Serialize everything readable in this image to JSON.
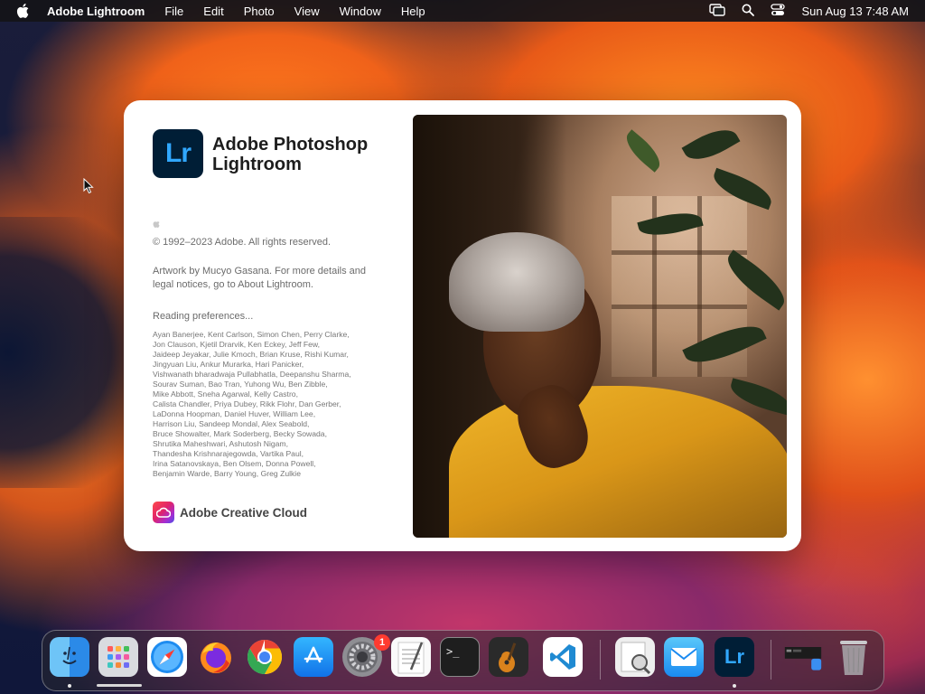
{
  "menubar": {
    "app_name": "Adobe Lightroom",
    "items": [
      "File",
      "Edit",
      "Photo",
      "View",
      "Window",
      "Help"
    ],
    "clock": "Sun Aug 13  7:48 AM"
  },
  "splash": {
    "logo_text": "Lr",
    "product_name": "Adobe Photoshop Lightroom",
    "copyright": "© 1992–2023 Adobe. All rights reserved.",
    "artwork_credit": "Artwork by Mucyo Gasana. For more details and legal notices, go to About Lightroom.",
    "status": "Reading preferences...",
    "credits": [
      "Ayan Banerjee, Kent Carlson, Simon Chen, Perry Clarke,",
      "Jon Clauson, Kjetil Drarvik, Ken Eckey, Jeff Few,",
      "Jaideep Jeyakar, Julie Kmoch, Brian Kruse, Rishi Kumar,",
      "Jingyuan Liu, Ankur Murarka, Hari Panicker,",
      "Vishwanath bharadwaja Pullabhatla, Deepanshu Sharma,",
      "Sourav Suman, Bao Tran, Yuhong Wu, Ben Zibble,",
      "Mike Abbott, Sneha Agarwal, Kelly Castro,",
      "Calista Chandler, Priya Dubey, Rikk Flohr, Dan Gerber,",
      "LaDonna Hoopman, Daniel Huver, William Lee,",
      "Harrison Liu, Sandeep Mondal, Alex Seabold,",
      "Bruce Showalter, Mark Soderberg, Becky Sowada,",
      "Shrutika Maheshwari, Ashutosh Nigam,",
      "Thandesha Krishnarajegowda, Vartika Paul,",
      "Irina Satanovskaya, Ben Olsem, Donna Powell,",
      "Benjamin Warde, Barry Young, Greg Zulkie"
    ],
    "creative_cloud_label": "Adobe Creative Cloud"
  },
  "dock": {
    "apps": [
      {
        "name": "Finder",
        "icon": "finder-icon",
        "running": true
      },
      {
        "name": "Launchpad",
        "icon": "launchpad-icon",
        "running": false
      },
      {
        "name": "Safari",
        "icon": "safari-icon",
        "running": false
      },
      {
        "name": "Firefox",
        "icon": "firefox-icon",
        "running": false
      },
      {
        "name": "Chrome",
        "icon": "chrome-icon",
        "running": false
      },
      {
        "name": "App Store",
        "icon": "app-store-icon",
        "running": false
      },
      {
        "name": "System Settings",
        "icon": "system-settings-icon",
        "running": false,
        "badge": "1"
      },
      {
        "name": "TextEdit",
        "icon": "textedit-icon",
        "running": false
      },
      {
        "name": "Terminal",
        "icon": "terminal-icon",
        "running": false
      },
      {
        "name": "GarageBand",
        "icon": "garageband-icon",
        "running": false
      },
      {
        "name": "Visual Studio Code",
        "icon": "vscode-icon",
        "running": false
      },
      {
        "name": "Preview",
        "icon": "preview-icon",
        "running": false
      },
      {
        "name": "Mail",
        "icon": "mail-icon",
        "running": false
      },
      {
        "name": "Lightroom",
        "icon": "lightroom-icon",
        "running": true
      },
      {
        "name": "Recent Window",
        "icon": "recent-window-icon",
        "running": false
      },
      {
        "name": "Trash",
        "icon": "trash-icon",
        "running": false
      }
    ],
    "system_settings_badge": "1",
    "terminal_prompt": ">_",
    "lightroom_text": "Lr"
  },
  "colors": {
    "lightroom_bg": "#001e36",
    "lightroom_accent": "#31a8ff",
    "badge": "#ff3b30"
  }
}
